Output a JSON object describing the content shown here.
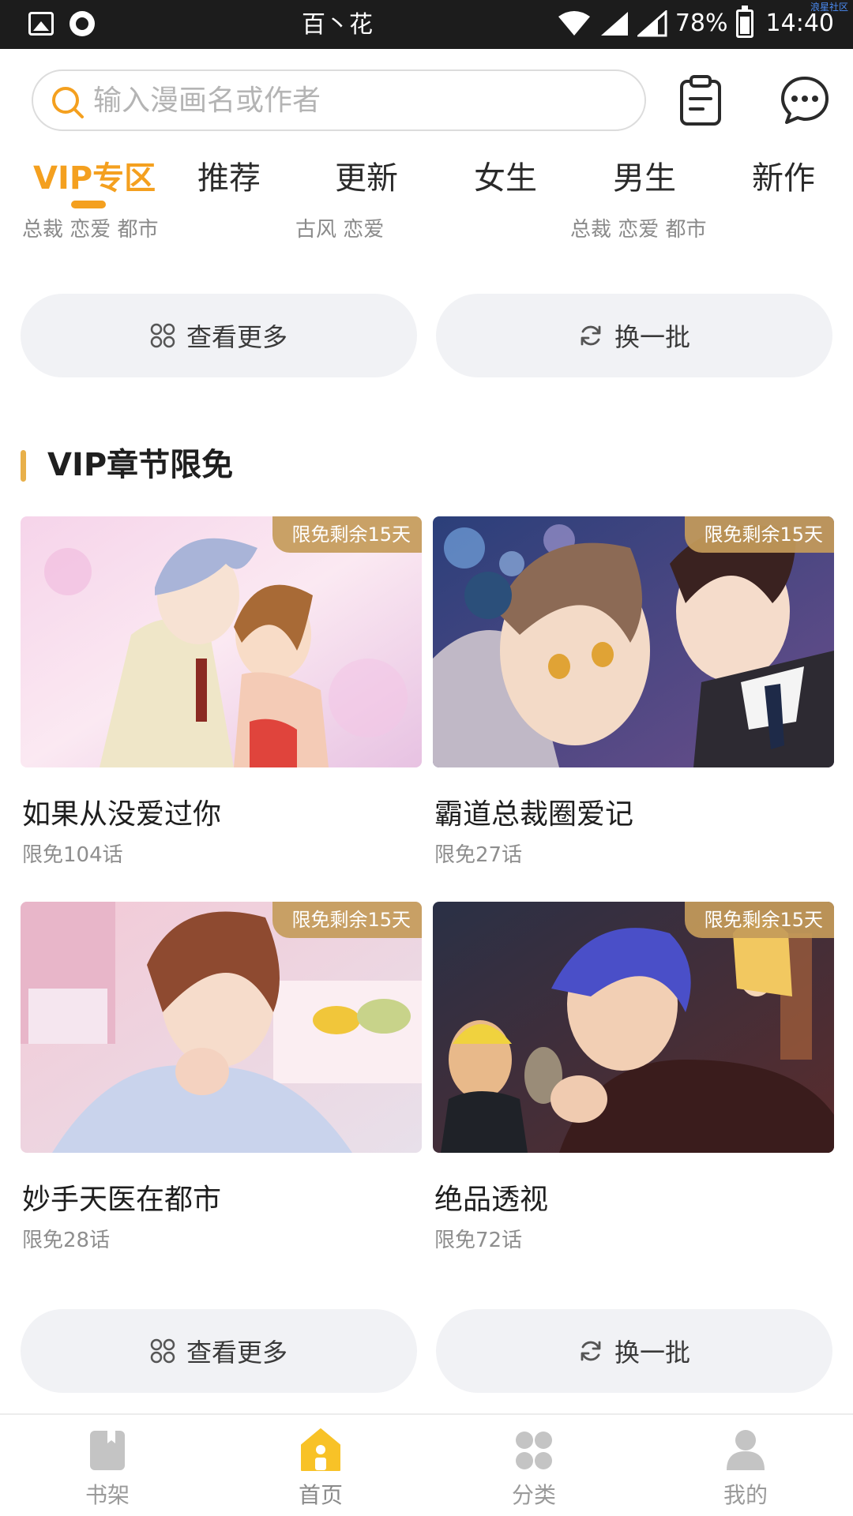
{
  "status_bar": {
    "carrier": "百丶花",
    "battery": "78%",
    "time": "14:40",
    "watermark": "浪星社区"
  },
  "search": {
    "placeholder": "输入漫画名或作者"
  },
  "tabs": [
    {
      "label": "VIP专区",
      "active": true
    },
    {
      "label": "推荐",
      "active": false
    },
    {
      "label": "更新",
      "active": false
    },
    {
      "label": "女生",
      "active": false
    },
    {
      "label": "男生",
      "active": false
    },
    {
      "label": "新作",
      "active": false
    }
  ],
  "tag_rows": [
    "总裁 恋爱 都市",
    "古风 恋爱",
    "总裁 恋爱 都市"
  ],
  "actions": {
    "more_label": "查看更多",
    "refresh_label": "换一批"
  },
  "section": {
    "title": "VIP章节限免"
  },
  "cards": [
    {
      "title": "如果从没爱过你",
      "sub": "限免104话",
      "badge": "限免剩余15天"
    },
    {
      "title": "霸道总裁圈爱记",
      "sub": "限免27话",
      "badge": "限免剩余15天"
    },
    {
      "title": "妙手天医在都市",
      "sub": "限免28话",
      "badge": "限免剩余15天"
    },
    {
      "title": "绝品透视",
      "sub": "限免72话",
      "badge": "限免剩余15天"
    }
  ],
  "bottom_nav": [
    {
      "label": "书架",
      "icon": "bookshelf-icon",
      "active": false
    },
    {
      "label": "首页",
      "icon": "home-icon",
      "active": true
    },
    {
      "label": "分类",
      "icon": "category-icon",
      "active": false
    },
    {
      "label": "我的",
      "icon": "profile-icon",
      "active": false
    }
  ],
  "colors": {
    "accent": "#f4a01f",
    "badge": "#c49b5a",
    "button_bg": "#f1f2f5",
    "section_bar": "#e8b04a"
  }
}
